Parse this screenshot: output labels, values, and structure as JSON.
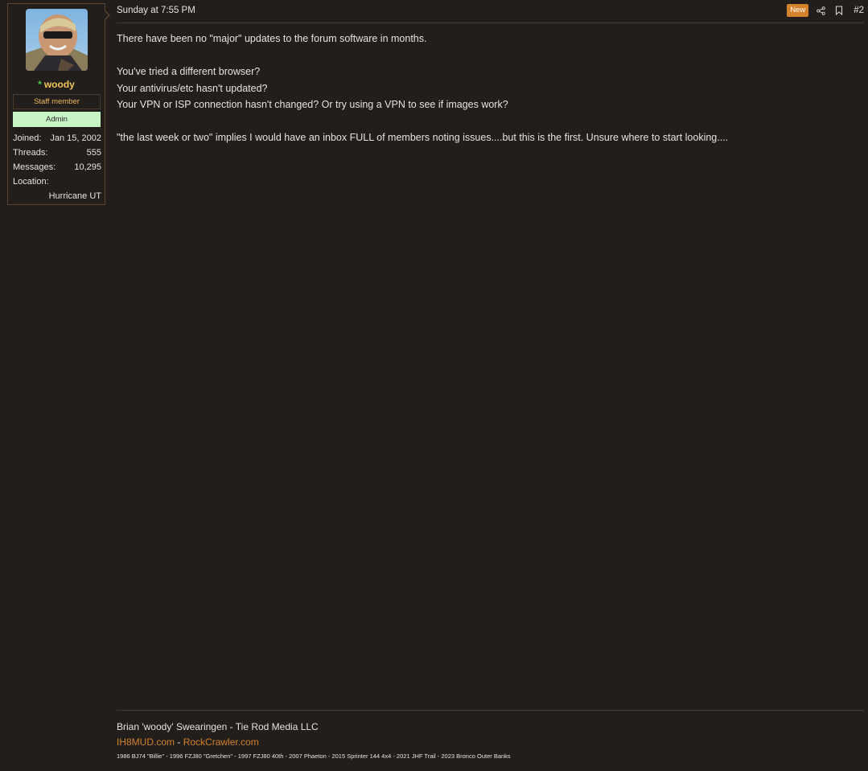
{
  "user": {
    "username": "woody",
    "star": "*",
    "staff_badge": "Staff member",
    "role_badge": "Admin",
    "stats": [
      {
        "label": "Joined:",
        "value": "Jan 15, 2002"
      },
      {
        "label": "Threads:",
        "value": "555"
      },
      {
        "label": "Messages:",
        "value": "10,295"
      }
    ],
    "location_label": "Location:",
    "location_value": "Hurricane UT"
  },
  "message": {
    "date": "Sunday at 7:55 PM",
    "new_badge": "New",
    "share_icon": "share-icon",
    "bookmark_icon": "bookmark-icon",
    "post_number": "#2",
    "paragraphs": [
      "There have been no \"major\" updates to the forum software in months.",
      "You've tried a different browser?",
      "Your antivirus/etc hasn't updated?",
      "Your VPN or ISP connection hasn't changed? Or try using a VPN to see if images work?",
      "\"the last week or two\" implies I would have an inbox FULL of members noting issues....but this is the first. Unsure where to start looking...."
    ]
  },
  "signature": {
    "line1": "Brian 'woody' Swearingen - Tie Rod Media LLC",
    "link1": "IH8MUD.com",
    "separator": "-",
    "link2": "RockCrawler.com",
    "line3": "1986 BJ74 \"Billie\" - 1996 FZJ80 \"Gretchen\" - 1997 FZJ80 40th - 2007 Phaeton - 2015 Sprinter 144 4x4 - 2021 JHF Trail - 2023 Bronco Outer Banks"
  },
  "colors": {
    "background": "#211e1c",
    "accent": "#d4822a",
    "username": "#f0c45a",
    "admin_badge": "#c8f5c6",
    "online_star": "#4ad04a"
  }
}
